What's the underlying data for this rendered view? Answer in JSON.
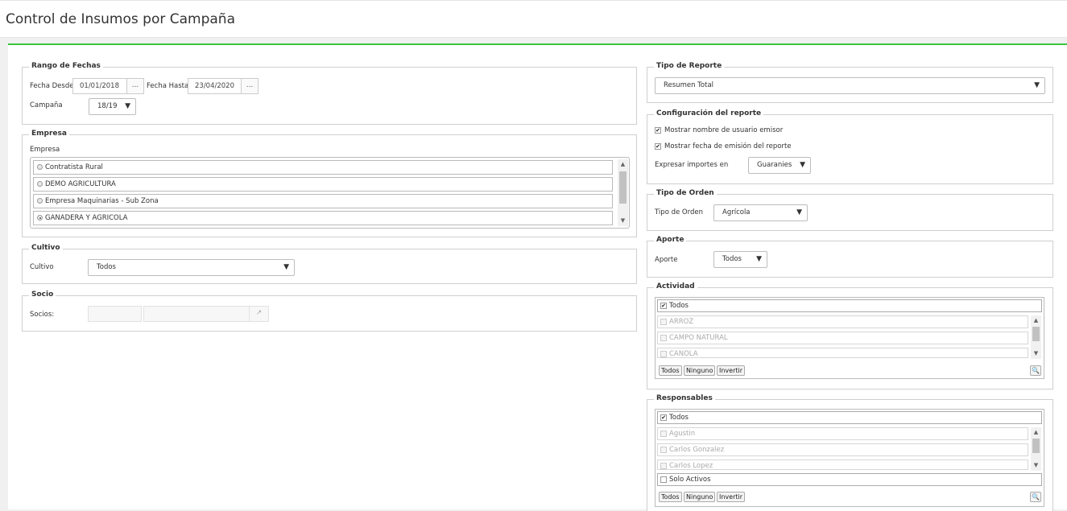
{
  "page": {
    "title": "Control de Insumos por Campaña"
  },
  "rango": {
    "legend": "Rango de Fechas",
    "desde_label": "Fecha Desde",
    "desde_value": "01/01/2018",
    "hasta_label": "Fecha Hasta",
    "hasta_value": "23/04/2020",
    "dots": "...",
    "campana_label": "Campaña",
    "campana_value": "18/19"
  },
  "empresa": {
    "legend": "Empresa",
    "label": "Empresa",
    "items": [
      {
        "label": "Contratista Rural",
        "selected": false
      },
      {
        "label": "DEMO AGRICULTURA",
        "selected": false
      },
      {
        "label": "Empresa Maquinarias - Sub Zona",
        "selected": false
      },
      {
        "label": "GANADERA Y AGRICOLA",
        "selected": true
      }
    ]
  },
  "cultivo": {
    "legend": "Cultivo",
    "label": "Cultivo",
    "value": "Todos"
  },
  "socio": {
    "legend": "Socio",
    "label": "Socios:"
  },
  "tipo_reporte": {
    "legend": "Tipo de Reporte",
    "value": "Resumen Total"
  },
  "config": {
    "legend": "Configuración del reporte",
    "opt1": "Mostrar nombre de usuario emisor",
    "opt2": "Mostrar fecha de emisión del reporte",
    "importes_label": "Expresar importes en",
    "importes_value": "Guaranies"
  },
  "tipo_orden": {
    "legend": "Tipo de Orden",
    "label": "Tipo de Orden",
    "value": "Agrícola"
  },
  "aporte": {
    "legend": "Aporte",
    "label": "Aporte",
    "value": "Todos"
  },
  "actividad": {
    "legend": "Actividad",
    "all_label": "Todos",
    "items": [
      "ARROZ",
      "CAMPO NATURAL",
      "CANOLA"
    ],
    "btn_todos": "Todos",
    "btn_ninguno": "Ninguno",
    "btn_invertir": "Invertir"
  },
  "responsables": {
    "legend": "Responsables",
    "all_label": "Todos",
    "items": [
      "Agustin",
      "Carlos Gonzalez",
      "Carlos Lopez"
    ],
    "solo_activos": "Solo Activos",
    "btn_todos": "Todos",
    "btn_ninguno": "Ninguno",
    "btn_invertir": "Invertir"
  },
  "icons": {
    "arrow": "▼",
    "arrow_up": "▲",
    "check": "✔",
    "search": "🔍",
    "external": "↗"
  }
}
